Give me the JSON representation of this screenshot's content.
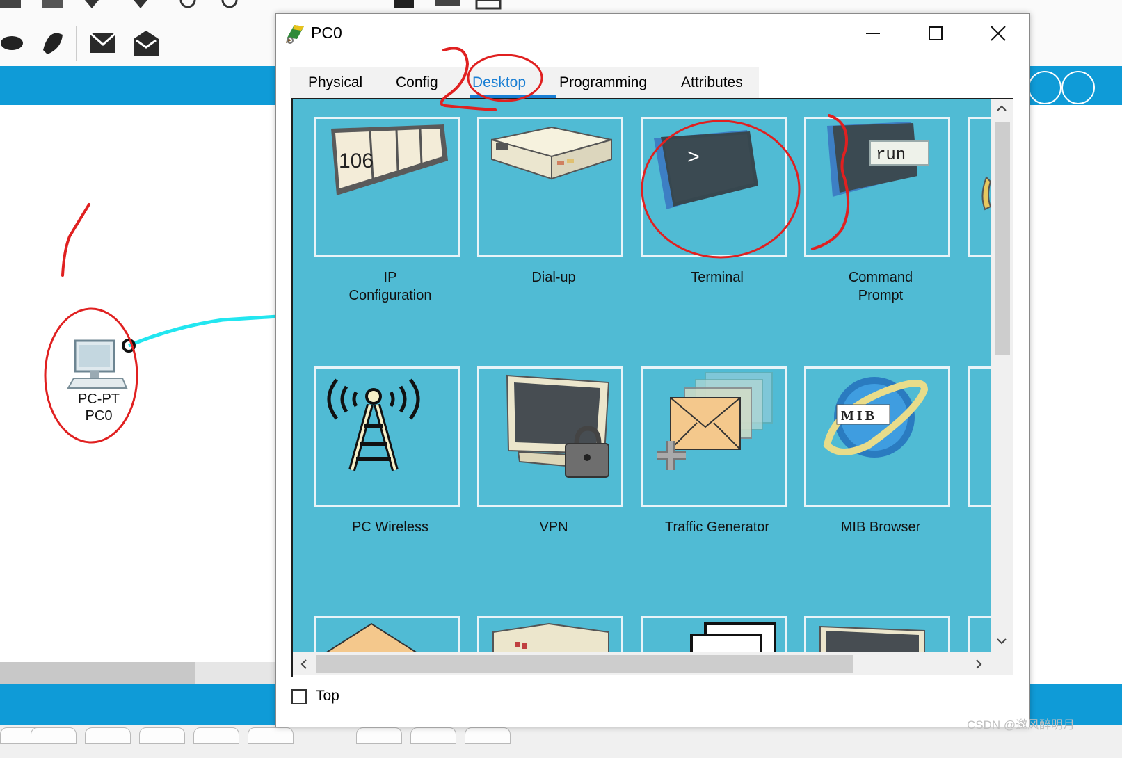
{
  "colors": {
    "accent_blue": "#0f9bd7",
    "content_bg": "#50bbd4",
    "active_tab": "#1a7fd4",
    "annotation_red": "#e02020",
    "link_cable": "#22e6f0"
  },
  "workspace": {
    "node": {
      "type_label": "PC-PT",
      "name_label": "PC0"
    }
  },
  "dialog": {
    "title": "PC0",
    "window_buttons": {
      "minimize": "—",
      "maximize": "☐",
      "close": "✕"
    },
    "tabs": [
      {
        "label": "Physical",
        "active": false
      },
      {
        "label": "Config",
        "active": false
      },
      {
        "label": "Desktop",
        "active": true
      },
      {
        "label": "Programming",
        "active": false
      },
      {
        "label": "Attributes",
        "active": false
      }
    ],
    "apps": [
      {
        "label": "IP\nConfiguration",
        "icon": "ip-config-icon"
      },
      {
        "label": "Dial-up",
        "icon": "modem-icon"
      },
      {
        "label": "Terminal",
        "icon": "terminal-icon"
      },
      {
        "label": "Command\nPrompt",
        "icon": "command-prompt-icon"
      },
      {
        "label": "PC Wireless",
        "icon": "wireless-tower-icon"
      },
      {
        "label": "VPN",
        "icon": "vpn-lock-icon"
      },
      {
        "label": "Traffic Generator",
        "icon": "traffic-generator-icon"
      },
      {
        "label": "MIB Browser",
        "icon": "mib-browser-icon"
      }
    ],
    "icon_text": {
      "ip_number": "106",
      "terminal_prompt": ">",
      "run_label": "run",
      "mib_label": "MIB"
    },
    "top_checkbox": {
      "label": "Top",
      "checked": false
    }
  },
  "annotations": [
    "1",
    "2"
  ],
  "watermark": "CSDN @邀风醉明月"
}
